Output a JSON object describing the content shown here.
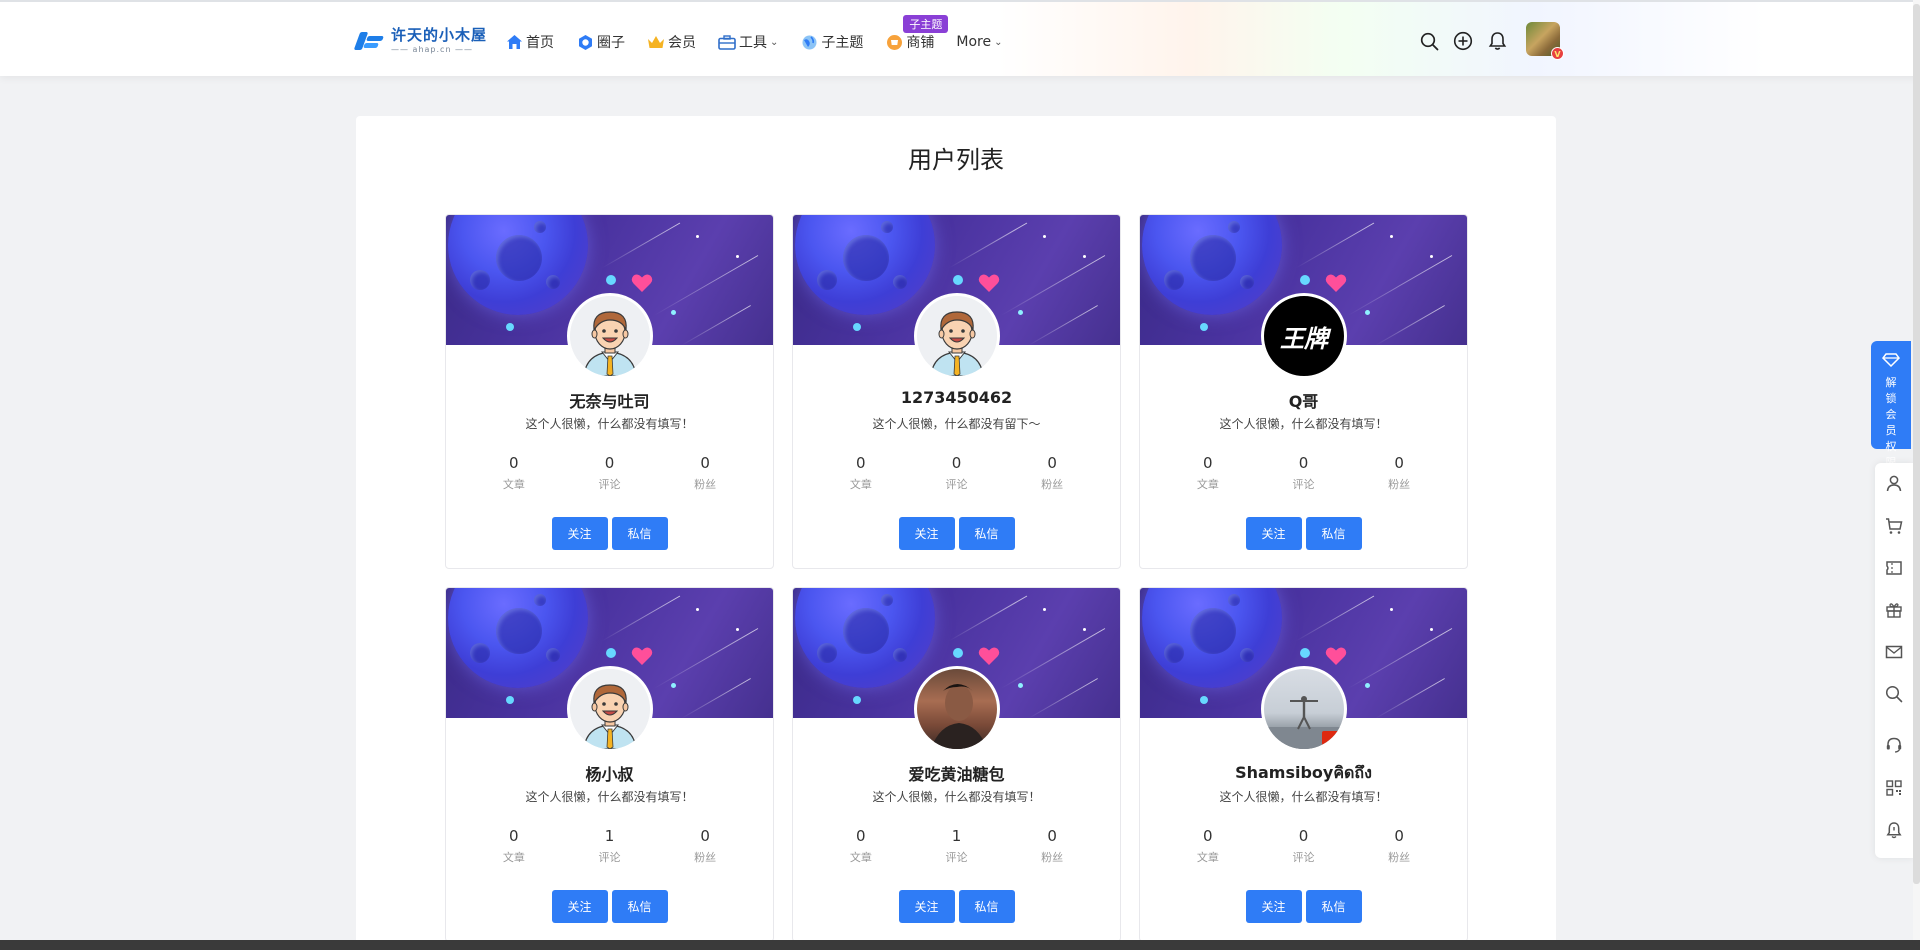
{
  "header": {
    "logo": {
      "title": "许天的小木屋",
      "subtitle": "—— ahap.cn ——"
    },
    "nav": [
      {
        "label": "首页",
        "icon": "home-icon",
        "dropdown": false
      },
      {
        "label": "圈子",
        "icon": "circle-hex-icon",
        "dropdown": false
      },
      {
        "label": "会员",
        "icon": "crown-icon",
        "dropdown": false
      },
      {
        "label": "工具",
        "icon": "toolbox-icon",
        "dropdown": true
      },
      {
        "label": "子主题",
        "icon": "globe-icon",
        "dropdown": false
      },
      {
        "label": "商铺",
        "icon": "shop-icon",
        "dropdown": false,
        "badge": "子主题"
      },
      {
        "label": "More",
        "icon": "",
        "dropdown": true
      }
    ],
    "actions": [
      "search-icon",
      "add-circle-icon",
      "bell-icon"
    ],
    "avatar_badge": "V"
  },
  "main": {
    "title": "用户列表",
    "follow_label": "关注",
    "message_label": "私信",
    "stat_labels": [
      "文章",
      "评论",
      "粉丝"
    ],
    "users": [
      {
        "name": "无奈与吐司",
        "desc": "这个人很懒，什么都没有填写！",
        "articles": "0",
        "comments": "0",
        "fans": "0",
        "avatar": "cartoon-man"
      },
      {
        "name": "1273450462",
        "desc": "这个人很懒，什么都没有留下～",
        "articles": "0",
        "comments": "0",
        "fans": "0",
        "avatar": "cartoon-man"
      },
      {
        "name": "Q哥",
        "desc": "这个人很懒，什么都没有填写！",
        "articles": "0",
        "comments": "0",
        "fans": "0",
        "avatar": "calligraphy-black"
      },
      {
        "name": "杨小叔",
        "desc": "这个人很懒，什么都没有填写！",
        "articles": "0",
        "comments": "1",
        "fans": "0",
        "avatar": "cartoon-man"
      },
      {
        "name": "爱吃黄油糖包",
        "desc": "这个人很懒，什么都没有填写！",
        "articles": "0",
        "comments": "1",
        "fans": "0",
        "avatar": "photo-man"
      },
      {
        "name": "Shamsiboyคิดถึง",
        "desc": "这个人很懒，什么都没有填写！",
        "articles": "0",
        "comments": "0",
        "fans": "0",
        "avatar": "photo-sky"
      }
    ]
  },
  "sidebar": {
    "unlock_label": "解锁会员权限",
    "icons": [
      "user-icon",
      "cart-icon",
      "ticket-icon",
      "gift-icon",
      "mail-icon",
      "search-icon",
      "headset-icon",
      "qrcode-icon",
      "notification-icon"
    ]
  },
  "colors": {
    "accent": "#2f7cf6",
    "badge": "#8a3fd6",
    "heart": "#ff4f9a",
    "cover": "#4a33a0"
  }
}
